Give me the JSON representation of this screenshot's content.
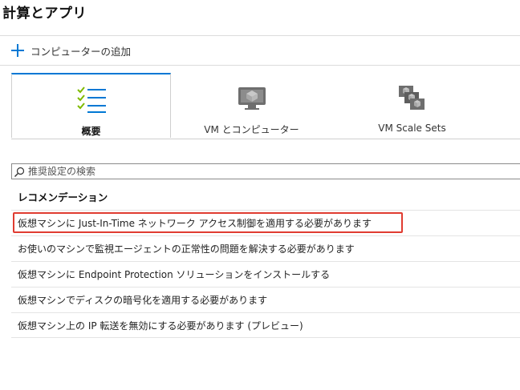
{
  "page": {
    "title": "計算とアプリ"
  },
  "command_bar": {
    "add_computer_label": "コンピューターの追加",
    "add_icon": "plus-icon"
  },
  "tabs": [
    {
      "label": "概要",
      "icon": "overview-checklist-icon",
      "active": true
    },
    {
      "label": "VM とコンピューター",
      "icon": "vm-computer-icon",
      "active": false
    },
    {
      "label": "VM Scale Sets",
      "icon": "vm-scale-sets-icon",
      "active": false
    }
  ],
  "search": {
    "placeholder": "推奨設定の検索",
    "value": ""
  },
  "recommendations": {
    "heading": "レコメンデーション",
    "items": [
      {
        "label": "仮想マシンに Just-In-Time ネットワーク アクセス制御を適用する必要があります",
        "highlighted": true
      },
      {
        "label": "お使いのマシンで監視エージェントの正常性の問題を解決する必要があります",
        "highlighted": false
      },
      {
        "label": "仮想マシンに Endpoint Protection ソリューションをインストールする",
        "highlighted": false
      },
      {
        "label": "仮想マシンでディスクの暗号化を適用する必要があります",
        "highlighted": false
      },
      {
        "label": "仮想マシン上の IP 転送を無効にする必要があります (プレビュー)",
        "highlighted": false
      }
    ]
  },
  "colors": {
    "accent": "#0078d4",
    "highlight": "#e03c31",
    "check_green": "#7fba00",
    "icon_gray": "#6e6e6e"
  }
}
